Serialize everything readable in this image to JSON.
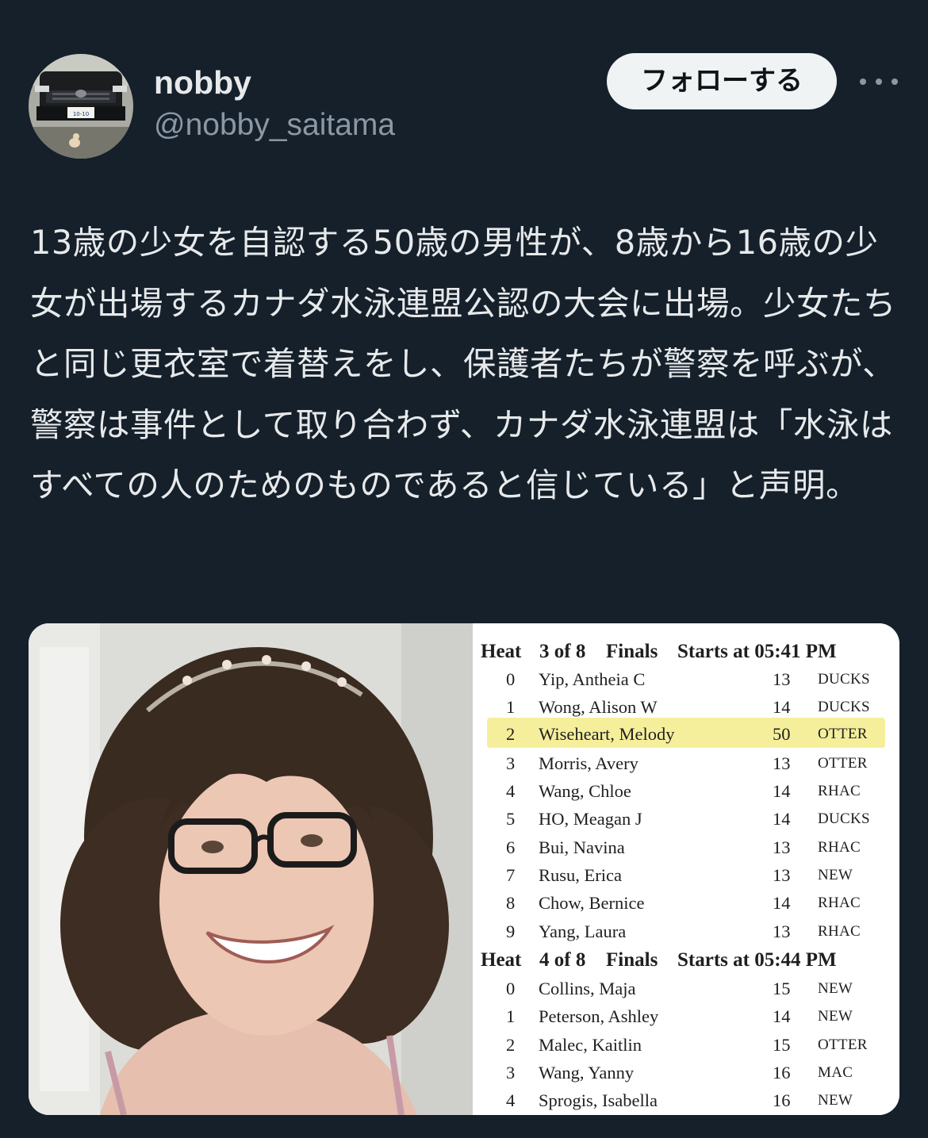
{
  "author": {
    "display_name": "nobby",
    "handle": "@nobby_saitama",
    "avatar_plate_text": "10-10"
  },
  "actions": {
    "follow_label": "フォローする",
    "more_icon": "more-dots-icon"
  },
  "tweet": {
    "text": "13歳の少女を自認する50歳の男性が、8歳から16歳の少女が出場するカナダ水泳連盟公認の大会に出場。少女たちと同じ更衣室で着替えをし、保護者たちが警察を呼ぶが、警察は事件として取り合わず、カナダ水泳連盟は「水泳はすべての人のためのものであると信じている」と声明。"
  },
  "heat_sheet": {
    "highlight_color": "#f5ef9c",
    "heats": [
      {
        "label": "Heat",
        "number": "3 of 8",
        "round": "Finals",
        "start": "Starts at 05:41 PM",
        "rows": [
          {
            "lane": "0",
            "name": "Yip, Antheia C",
            "age": "13",
            "team": "DUCKS"
          },
          {
            "lane": "1",
            "name": "Wong, Alison W",
            "age": "14",
            "team": "DUCKS"
          },
          {
            "lane": "2",
            "name": "Wiseheart, Melody",
            "age": "50",
            "team": "OTTER",
            "highlighted": true
          },
          {
            "lane": "3",
            "name": "Morris, Avery",
            "age": "13",
            "team": "OTTER"
          },
          {
            "lane": "4",
            "name": "Wang, Chloe",
            "age": "14",
            "team": "RHAC"
          },
          {
            "lane": "5",
            "name": "HO, Meagan J",
            "age": "14",
            "team": "DUCKS"
          },
          {
            "lane": "6",
            "name": "Bui, Navina",
            "age": "13",
            "team": "RHAC"
          },
          {
            "lane": "7",
            "name": "Rusu, Erica",
            "age": "13",
            "team": "NEW"
          },
          {
            "lane": "8",
            "name": "Chow, Bernice",
            "age": "14",
            "team": "RHAC"
          },
          {
            "lane": "9",
            "name": "Yang, Laura",
            "age": "13",
            "team": "RHAC"
          }
        ]
      },
      {
        "label": "Heat",
        "number": "4 of 8",
        "round": "Finals",
        "start": "Starts at 05:44 PM",
        "rows": [
          {
            "lane": "0",
            "name": "Collins, Maja",
            "age": "15",
            "team": "NEW"
          },
          {
            "lane": "1",
            "name": "Peterson, Ashley",
            "age": "14",
            "team": "NEW"
          },
          {
            "lane": "2",
            "name": "Malec, Kaitlin",
            "age": "15",
            "team": "OTTER"
          },
          {
            "lane": "3",
            "name": "Wang, Yanny",
            "age": "16",
            "team": "MAC"
          },
          {
            "lane": "4",
            "name": "Sprogis, Isabella",
            "age": "16",
            "team": "NEW"
          }
        ]
      }
    ]
  }
}
